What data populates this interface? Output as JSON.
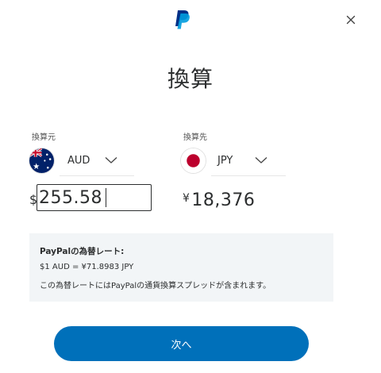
{
  "header": {
    "logo_icon": "paypal-logo-icon",
    "close_icon": "close-icon",
    "title": "換算"
  },
  "from": {
    "label": "換算元",
    "currency_code": "AUD",
    "flag_icon": "australia-flag-icon",
    "symbol": "$",
    "amount": "255.58"
  },
  "to": {
    "label": "換算先",
    "currency_code": "JPY",
    "flag_icon": "japan-flag-icon",
    "symbol": "¥",
    "amount": "18,376"
  },
  "rate_info": {
    "title": "PayPalの為替レート:",
    "value": "$1 AUD = ¥71.8983 JPY",
    "note": "この為替レートにはPayPalの通貨換算スプレッドが含まれます。"
  },
  "actions": {
    "next_label": "次へ"
  },
  "colors": {
    "primary_button": "#0070ba",
    "info_background": "#f2f5f7",
    "text": "#2c2e2f",
    "paypal_dark_blue": "#003087",
    "paypal_light_blue": "#009cde"
  }
}
